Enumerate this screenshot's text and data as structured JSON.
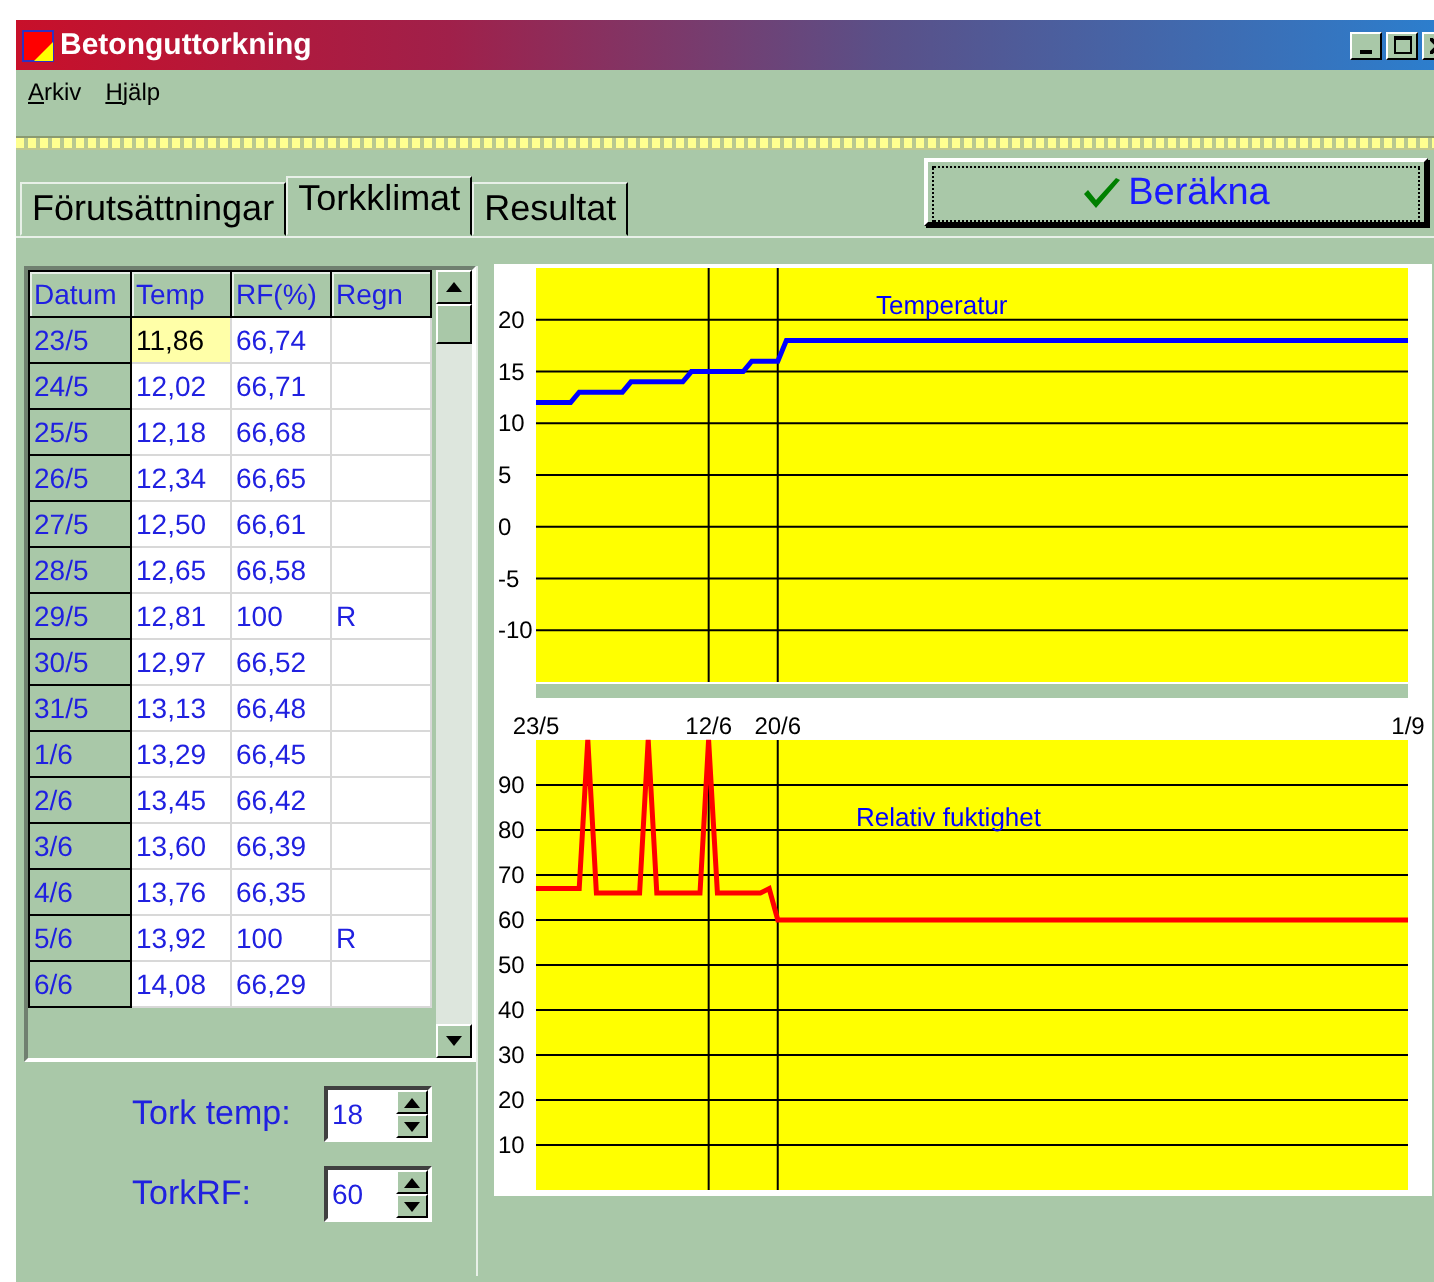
{
  "window": {
    "title": "Betonguttorkning"
  },
  "menu": [
    {
      "label": "Arkiv"
    },
    {
      "label": "Hjälp"
    }
  ],
  "tabs": [
    {
      "label": "Förutsättningar",
      "selected": false
    },
    {
      "label": "Torkklimat",
      "selected": true
    },
    {
      "label": "Resultat",
      "selected": false
    }
  ],
  "calculate_button": {
    "label": "Beräkna"
  },
  "table": {
    "columns": [
      "Datum",
      "Temp",
      "RF(%)",
      "Regn"
    ],
    "rows": [
      {
        "cells": [
          "23/5",
          "11,86",
          "66,74",
          ""
        ],
        "selected": true
      },
      {
        "cells": [
          "24/5",
          "12,02",
          "66,71",
          ""
        ],
        "selected": false
      },
      {
        "cells": [
          "25/5",
          "12,18",
          "66,68",
          ""
        ],
        "selected": false
      },
      {
        "cells": [
          "26/5",
          "12,34",
          "66,65",
          ""
        ],
        "selected": false
      },
      {
        "cells": [
          "27/5",
          "12,50",
          "66,61",
          ""
        ],
        "selected": false
      },
      {
        "cells": [
          "28/5",
          "12,65",
          "66,58",
          ""
        ],
        "selected": false
      },
      {
        "cells": [
          "29/5",
          "12,81",
          "100",
          "R"
        ],
        "selected": false
      },
      {
        "cells": [
          "30/5",
          "12,97",
          "66,52",
          ""
        ],
        "selected": false
      },
      {
        "cells": [
          "31/5",
          "13,13",
          "66,48",
          ""
        ],
        "selected": false
      },
      {
        "cells": [
          "1/6",
          "13,29",
          "66,45",
          ""
        ],
        "selected": false
      },
      {
        "cells": [
          "2/6",
          "13,45",
          "66,42",
          ""
        ],
        "selected": false
      },
      {
        "cells": [
          "3/6",
          "13,60",
          "66,39",
          ""
        ],
        "selected": false
      },
      {
        "cells": [
          "4/6",
          "13,76",
          "66,35",
          ""
        ],
        "selected": false
      },
      {
        "cells": [
          "5/6",
          "13,92",
          "100",
          "R"
        ],
        "selected": false
      },
      {
        "cells": [
          "6/6",
          "14,08",
          "66,29",
          ""
        ],
        "selected": false
      }
    ]
  },
  "settings": [
    {
      "label": "Tork temp:",
      "value": "18"
    },
    {
      "label": "TorkRF:",
      "value": "60"
    }
  ],
  "charts": [
    {
      "chart_data": {
        "type": "line",
        "categories": [
          "23/5",
          null,
          null,
          null,
          null,
          null,
          null,
          null,
          null,
          null,
          null,
          null,
          null,
          null,
          null,
          null,
          null,
          null,
          null,
          null,
          "12/6",
          null,
          null,
          null,
          null,
          null,
          null,
          null,
          "20/6",
          null,
          null,
          null,
          null,
          null,
          null,
          null,
          null,
          null,
          null,
          null,
          null,
          null,
          null,
          null,
          null,
          null,
          null,
          null,
          null,
          null,
          null,
          null,
          null,
          null,
          null,
          null,
          null,
          null,
          null,
          null,
          null,
          null,
          null,
          null,
          null,
          null,
          null,
          null,
          null,
          null,
          null,
          null,
          null,
          null,
          null,
          null,
          null,
          null,
          null,
          null,
          null,
          null,
          null,
          null,
          null,
          null,
          null,
          null,
          null,
          null,
          null,
          null,
          null,
          null,
          null,
          null,
          null,
          null,
          null,
          null,
          null,
          "1/9"
        ],
        "series": [
          {
            "name": "Temperatur",
            "color": "#0000ff",
            "values": [
              12,
              12,
              12,
              12,
              12,
              13,
              13,
              13,
              13,
              13,
              13,
              14,
              14,
              14,
              14,
              14,
              14,
              14,
              15,
              15,
              15,
              15,
              15,
              15,
              15,
              16,
              16,
              16,
              16,
              18,
              18,
              18,
              18,
              18,
              18,
              18,
              18,
              18,
              18,
              18,
              18,
              18,
              18,
              18,
              18,
              18,
              18,
              18,
              18,
              18,
              18,
              18,
              18,
              18,
              18,
              18,
              18,
              18,
              18,
              18,
              18,
              18,
              18,
              18,
              18,
              18,
              18,
              18,
              18,
              18,
              18,
              18,
              18,
              18,
              18,
              18,
              18,
              18,
              18,
              18,
              18,
              18,
              18,
              18,
              18,
              18,
              18,
              18,
              18,
              18,
              18,
              18,
              18,
              18,
              18,
              18,
              18,
              18,
              18,
              18,
              18,
              18
            ]
          }
        ],
        "ylim": [
          -15,
          25
        ],
        "grid": true,
        "yticks": [
          20,
          15,
          10,
          5,
          0,
          -5,
          -10
        ]
      }
    },
    {
      "chart_data": {
        "type": "line",
        "categories": [
          null,
          null,
          null,
          null,
          null,
          null,
          null,
          null,
          null,
          null,
          null,
          null,
          null,
          null,
          null,
          null,
          null,
          null,
          null,
          null,
          null,
          null,
          null,
          null,
          null,
          null,
          null,
          null,
          null,
          null,
          null,
          null,
          null,
          null,
          null,
          null,
          null,
          null,
          null,
          null,
          null,
          null,
          null,
          null,
          null,
          null,
          null,
          null,
          null,
          null,
          null,
          null,
          null,
          null,
          null,
          null,
          null,
          null,
          null,
          null,
          null,
          null,
          null,
          null,
          null,
          null,
          null,
          null,
          null,
          null,
          null,
          null,
          null,
          null,
          null,
          null,
          null,
          null,
          null,
          null,
          null,
          null,
          null,
          null,
          null,
          null,
          null,
          null,
          null,
          null,
          null,
          null,
          null,
          null,
          null,
          null,
          null,
          null,
          null,
          null,
          null,
          null
        ],
        "series": [
          {
            "name": "Relativ fuktighet",
            "color": "#ff0000",
            "values": [
              67,
              67,
              67,
              67,
              67,
              67,
              100,
              66,
              66,
              66,
              66,
              66,
              66,
              100,
              66,
              66,
              66,
              66,
              66,
              66,
              100,
              66,
              66,
              66,
              66,
              66,
              66,
              67,
              60,
              60,
              60,
              60,
              60,
              60,
              60,
              60,
              60,
              60,
              60,
              60,
              60,
              60,
              60,
              60,
              60,
              60,
              60,
              60,
              60,
              60,
              60,
              60,
              60,
              60,
              60,
              60,
              60,
              60,
              60,
              60,
              60,
              60,
              60,
              60,
              60,
              60,
              60,
              60,
              60,
              60,
              60,
              60,
              60,
              60,
              60,
              60,
              60,
              60,
              60,
              60,
              60,
              60,
              60,
              60,
              60,
              60,
              60,
              60,
              60,
              60,
              60,
              60,
              60,
              60,
              60,
              60,
              60,
              60,
              60,
              60,
              60,
              60
            ]
          }
        ],
        "ylim": [
          0,
          100
        ],
        "grid": true,
        "yticks": [
          90,
          80,
          70,
          60,
          50,
          40,
          30,
          20,
          10
        ]
      }
    }
  ]
}
